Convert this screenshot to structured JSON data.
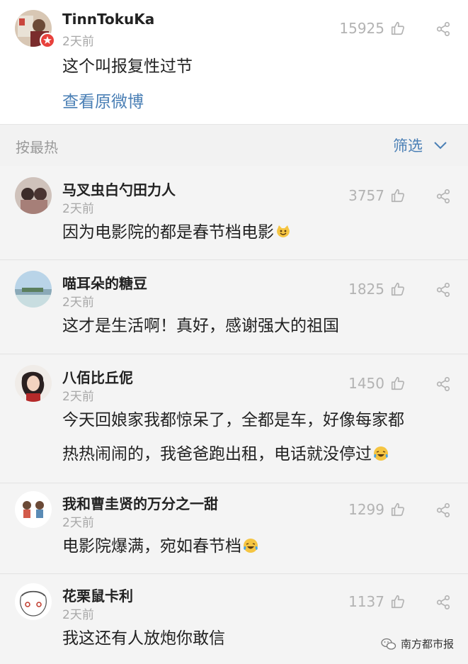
{
  "top_post": {
    "username": "TinnTokuKa",
    "time": "2天前",
    "likes": "15925",
    "text": "这个叫报复性过节",
    "view_original": "查看原微博"
  },
  "sort_bar": {
    "sort_label": "按最热",
    "filter_label": "筛选"
  },
  "comments": [
    {
      "username": "马叉虫白勺田力人",
      "time": "2天前",
      "likes": "3757",
      "lines": [
        "因为电影院的都是春节档电影"
      ],
      "emoji": "grinning-cat-emoji"
    },
    {
      "username": "喵耳朵的糖豆",
      "time": "2天前",
      "likes": "1825",
      "lines": [
        "这才是生活啊！真好，感谢强大的祖国"
      ]
    },
    {
      "username": "八佰比丘伲",
      "time": "2天前",
      "likes": "1450",
      "lines": [
        "今天回娘家我都惊呆了，全都是车，好像每家都",
        "热热闹闹的，我爸爸跑出租，电话就没停过"
      ],
      "emoji": "laughing-tears-emoji"
    },
    {
      "username": "我和曹圭贤的万分之一甜",
      "time": "2天前",
      "likes": "1299",
      "lines": [
        "电影院爆满，宛如春节档"
      ],
      "emoji": "laughing-tears-emoji"
    },
    {
      "username": "花栗鼠卡利",
      "time": "2天前",
      "likes": "1137",
      "lines": [
        "我这还有人放炮你敢信"
      ]
    }
  ],
  "watermark": "南方都市报",
  "colors": {
    "link": "#4a7fb5",
    "muted": "#a8a8a8",
    "background": "#f2f2f2"
  }
}
